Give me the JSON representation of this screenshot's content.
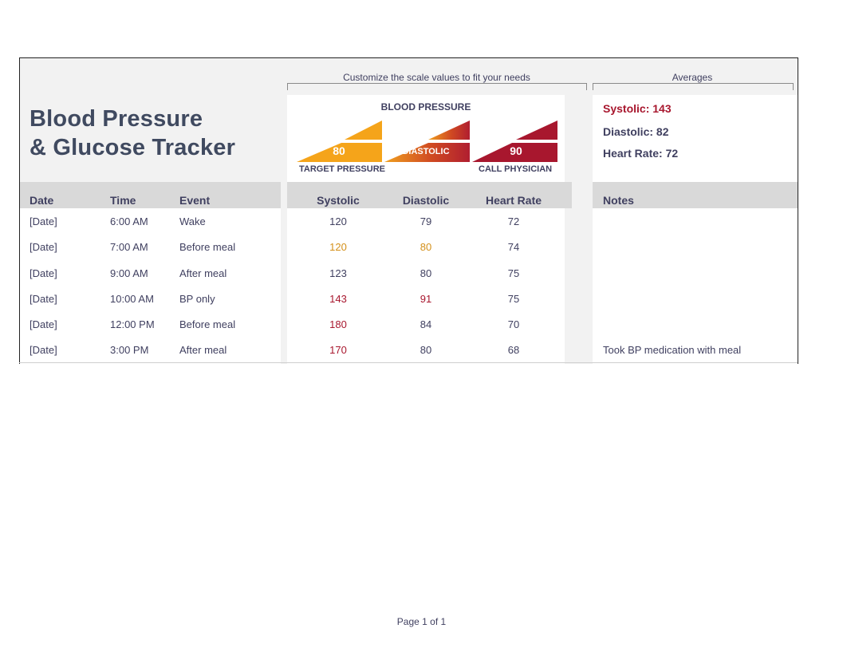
{
  "title": {
    "line1": "Blood Pressure",
    "line2": "& Glucose Tracker"
  },
  "captions": {
    "scale": "Customize the scale values  to fit your needs",
    "averages": "Averages"
  },
  "legend": {
    "title": "BLOOD PRESSURE",
    "target_value": "80",
    "diastolic_label": "DIASTOLIC",
    "call_value": "90",
    "target_label": "TARGET PRESSURE",
    "call_label": "CALL PHYSICIAN",
    "colors": {
      "target": "#f5a41a",
      "mid_start": "#f0a020",
      "mid_end": "#b01e30",
      "call": "#a8172e"
    }
  },
  "averages": {
    "systolic": "Systolic: 143",
    "diastolic": "Diastolic: 82",
    "heart_rate": "Heart Rate: 72"
  },
  "columns": {
    "date": "Date",
    "time": "Time",
    "event": "Event",
    "systolic": "Systolic",
    "diastolic": "Diastolic",
    "heart_rate": "Heart Rate",
    "notes": "Notes"
  },
  "rows": [
    {
      "date": "[Date]",
      "time": "6:00 AM",
      "event": "Wake",
      "systolic": "120",
      "diastolic": "79",
      "heart_rate": "72",
      "notes": "",
      "sys_status": "normal",
      "dia_status": "normal"
    },
    {
      "date": "[Date]",
      "time": "7:00 AM",
      "event": "Before meal",
      "systolic": "120",
      "diastolic": "80",
      "heart_rate": "74",
      "notes": "",
      "sys_status": "target",
      "dia_status": "target"
    },
    {
      "date": "[Date]",
      "time": "9:00 AM",
      "event": "After meal",
      "systolic": "123",
      "diastolic": "80",
      "heart_rate": "75",
      "notes": "",
      "sys_status": "normal",
      "dia_status": "normal"
    },
    {
      "date": "[Date]",
      "time": "10:00 AM",
      "event": "BP only",
      "systolic": "143",
      "diastolic": "91",
      "heart_rate": "75",
      "notes": "",
      "sys_status": "high",
      "dia_status": "high"
    },
    {
      "date": "[Date]",
      "time": "12:00 PM",
      "event": "Before meal",
      "systolic": "180",
      "diastolic": "84",
      "heart_rate": "70",
      "notes": "",
      "sys_status": "high",
      "dia_status": "normal"
    },
    {
      "date": "[Date]",
      "time": "3:00 PM",
      "event": "After meal",
      "systolic": "170",
      "diastolic": "80",
      "heart_rate": "68",
      "notes": "Took BP medication with meal",
      "sys_status": "high",
      "dia_status": "normal"
    }
  ],
  "status_colors": {
    "normal": "#404060",
    "target": "#d4901a",
    "high": "#a8172e",
    "avg_systolic": "#a8172e"
  },
  "footer": {
    "page": "Page 1 of 1"
  }
}
